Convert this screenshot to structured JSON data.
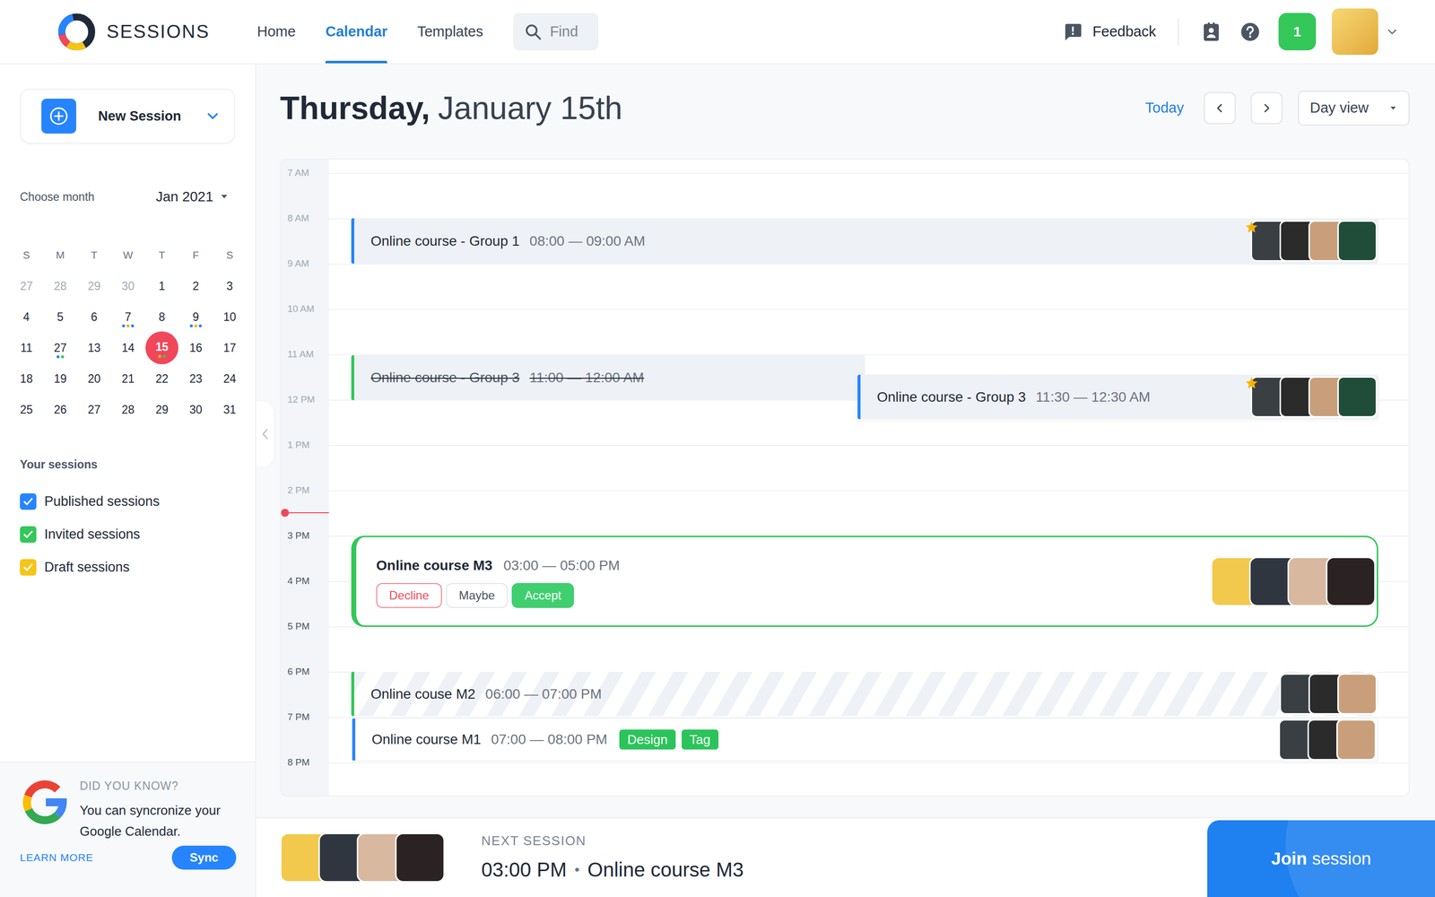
{
  "app": {
    "name": "SESSIONS"
  },
  "nav": [
    {
      "label": "Home",
      "selected": false
    },
    {
      "label": "Calendar",
      "selected": true
    },
    {
      "label": "Templates",
      "selected": false
    }
  ],
  "search": {
    "placeholder": "Find"
  },
  "toolbar": {
    "feedback": "Feedback",
    "notifications": "1"
  },
  "sidebar": {
    "new_session": "New Session",
    "month_label": "Choose month",
    "month": "Jan 2021",
    "weekdays": [
      "S",
      "M",
      "T",
      "W",
      "T",
      "F",
      "S"
    ],
    "weeks": [
      [
        {
          "day": "27",
          "muted": true,
          "selected": false,
          "dots": []
        },
        {
          "day": "28",
          "muted": true,
          "selected": false,
          "dots": []
        },
        {
          "day": "29",
          "muted": true,
          "selected": false,
          "dots": []
        },
        {
          "day": "30",
          "muted": true,
          "selected": false,
          "dots": []
        },
        {
          "day": "1",
          "muted": false,
          "selected": false,
          "dots": []
        },
        {
          "day": "2",
          "muted": false,
          "selected": false,
          "dots": []
        },
        {
          "day": "3",
          "muted": false,
          "selected": false,
          "dots": []
        }
      ],
      [
        {
          "day": "4",
          "muted": false,
          "selected": false,
          "dots": []
        },
        {
          "day": "5",
          "muted": false,
          "selected": false,
          "dots": []
        },
        {
          "day": "6",
          "muted": false,
          "selected": false,
          "dots": []
        },
        {
          "day": "7",
          "muted": false,
          "selected": false,
          "dots": [
            "#2684ff",
            "#f5b300",
            "#2684ff"
          ]
        },
        {
          "day": "8",
          "muted": false,
          "selected": false,
          "dots": []
        },
        {
          "day": "9",
          "muted": false,
          "selected": false,
          "dots": [
            "#2684ff",
            "#f5b300",
            "#2684ff"
          ]
        },
        {
          "day": "10",
          "muted": false,
          "selected": false,
          "dots": []
        }
      ],
      [
        {
          "day": "11",
          "muted": false,
          "selected": false,
          "dots": []
        },
        {
          "day": "27",
          "muted": false,
          "selected": false,
          "dots": [
            "#2684ff",
            "#34c759"
          ]
        },
        {
          "day": "13",
          "muted": false,
          "selected": false,
          "dots": []
        },
        {
          "day": "14",
          "muted": false,
          "selected": false,
          "dots": []
        },
        {
          "day": "15",
          "muted": false,
          "selected": true,
          "dots": [
            "#f5b300",
            "#34c759"
          ]
        },
        {
          "day": "16",
          "muted": false,
          "selected": false,
          "dots": []
        },
        {
          "day": "17",
          "muted": false,
          "selected": false,
          "dots": []
        }
      ],
      [
        {
          "day": "18",
          "muted": false,
          "selected": false,
          "dots": []
        },
        {
          "day": "19",
          "muted": false,
          "selected": false,
          "dots": []
        },
        {
          "day": "20",
          "muted": false,
          "selected": false,
          "dots": []
        },
        {
          "day": "21",
          "muted": false,
          "selected": false,
          "dots": []
        },
        {
          "day": "22",
          "muted": false,
          "selected": false,
          "dots": []
        },
        {
          "day": "23",
          "muted": false,
          "selected": false,
          "dots": []
        },
        {
          "day": "24",
          "muted": false,
          "selected": false,
          "dots": []
        }
      ],
      [
        {
          "day": "25",
          "muted": false,
          "selected": false,
          "dots": []
        },
        {
          "day": "26",
          "muted": false,
          "selected": false,
          "dots": []
        },
        {
          "day": "27",
          "muted": false,
          "selected": false,
          "dots": []
        },
        {
          "day": "28",
          "muted": false,
          "selected": false,
          "dots": []
        },
        {
          "day": "29",
          "muted": false,
          "selected": false,
          "dots": []
        },
        {
          "day": "30",
          "muted": false,
          "selected": false,
          "dots": []
        },
        {
          "day": "31",
          "muted": false,
          "selected": false,
          "dots": []
        }
      ]
    ],
    "sessions_title": "Your sessions",
    "filters": [
      {
        "label": "Published sessions",
        "checked": true,
        "color": "#2684ff"
      },
      {
        "label": "Invited sessions",
        "checked": true,
        "color": "#34c759"
      },
      {
        "label": "Draft sessions",
        "checked": true,
        "color": "#f5c518"
      }
    ],
    "tip": {
      "title": "DID YOU KNOW?",
      "text": "You can syncronize your Google Calendar.",
      "link": "LEARN MORE",
      "button": "Sync"
    }
  },
  "header": {
    "day": "Thursday,",
    "date": "January 15th",
    "today": "Today",
    "view": "Day view"
  },
  "hours": [
    {
      "label": "7 AM",
      "past": true
    },
    {
      "label": "8 AM",
      "past": true
    },
    {
      "label": "9 AM",
      "past": true
    },
    {
      "label": "10 AM",
      "past": true
    },
    {
      "label": "11 AM",
      "past": true
    },
    {
      "label": "12 PM",
      "past": true
    },
    {
      "label": "1 PM",
      "past": true
    },
    {
      "label": "2 PM",
      "past": true
    },
    {
      "label": "3 PM",
      "past": false
    },
    {
      "label": "4 PM",
      "past": false
    },
    {
      "label": "5 PM",
      "past": false
    },
    {
      "label": "6 PM",
      "past": false
    },
    {
      "label": "7 PM",
      "past": false
    },
    {
      "label": "8 PM",
      "past": false
    }
  ],
  "events": [
    {
      "title": "Online course - Group 1",
      "time": "08:00 — 09:00 AM",
      "color": "#2684ff",
      "kind": "past",
      "cancelled": false,
      "starred": true,
      "attendees": 4,
      "tags": [],
      "actions": []
    },
    {
      "title": "Online course - Group 3",
      "time": "11:00 — 12:00 AM",
      "color": "#34c759",
      "kind": "past",
      "cancelled": true,
      "starred": false,
      "attendees": 0,
      "tags": [],
      "actions": []
    },
    {
      "title": "Online course - Group 3",
      "time": "11:30 — 12:30 AM",
      "color": "#2684ff",
      "kind": "past",
      "cancelled": false,
      "starred": true,
      "attendees": 4,
      "tags": [],
      "actions": []
    },
    {
      "title": "Online course M3",
      "time": "03:00 — 05:00 PM",
      "color": "#34c759",
      "kind": "invite",
      "cancelled": false,
      "starred": false,
      "attendees": 4,
      "tags": [],
      "actions": [
        {
          "label": "Decline",
          "kind": "decline"
        },
        {
          "label": "Maybe",
          "kind": "maybe"
        },
        {
          "label": "Accept",
          "kind": "accept"
        }
      ]
    },
    {
      "title": "Online couse M2",
      "time": "06:00 — 07:00 PM",
      "color": "#34c759",
      "kind": "tentative",
      "cancelled": false,
      "starred": false,
      "attendees": 3,
      "tags": [],
      "actions": []
    },
    {
      "title": "Online course M1",
      "time": "07:00 — 08:00 PM",
      "color": "#2684ff",
      "kind": "upcoming",
      "cancelled": false,
      "starred": false,
      "attendees": 3,
      "tags": [
        {
          "label": "Design",
          "color": "#2bc45a"
        },
        {
          "label": "Tag",
          "color": "#2bc45a"
        }
      ],
      "actions": []
    }
  ],
  "next_session": {
    "label": "NEXT SESSION",
    "time": "03:00 PM",
    "separator": "•",
    "title": "Online course M3",
    "attendees": 4,
    "join_bold": "Join",
    "join_rest": "session"
  }
}
